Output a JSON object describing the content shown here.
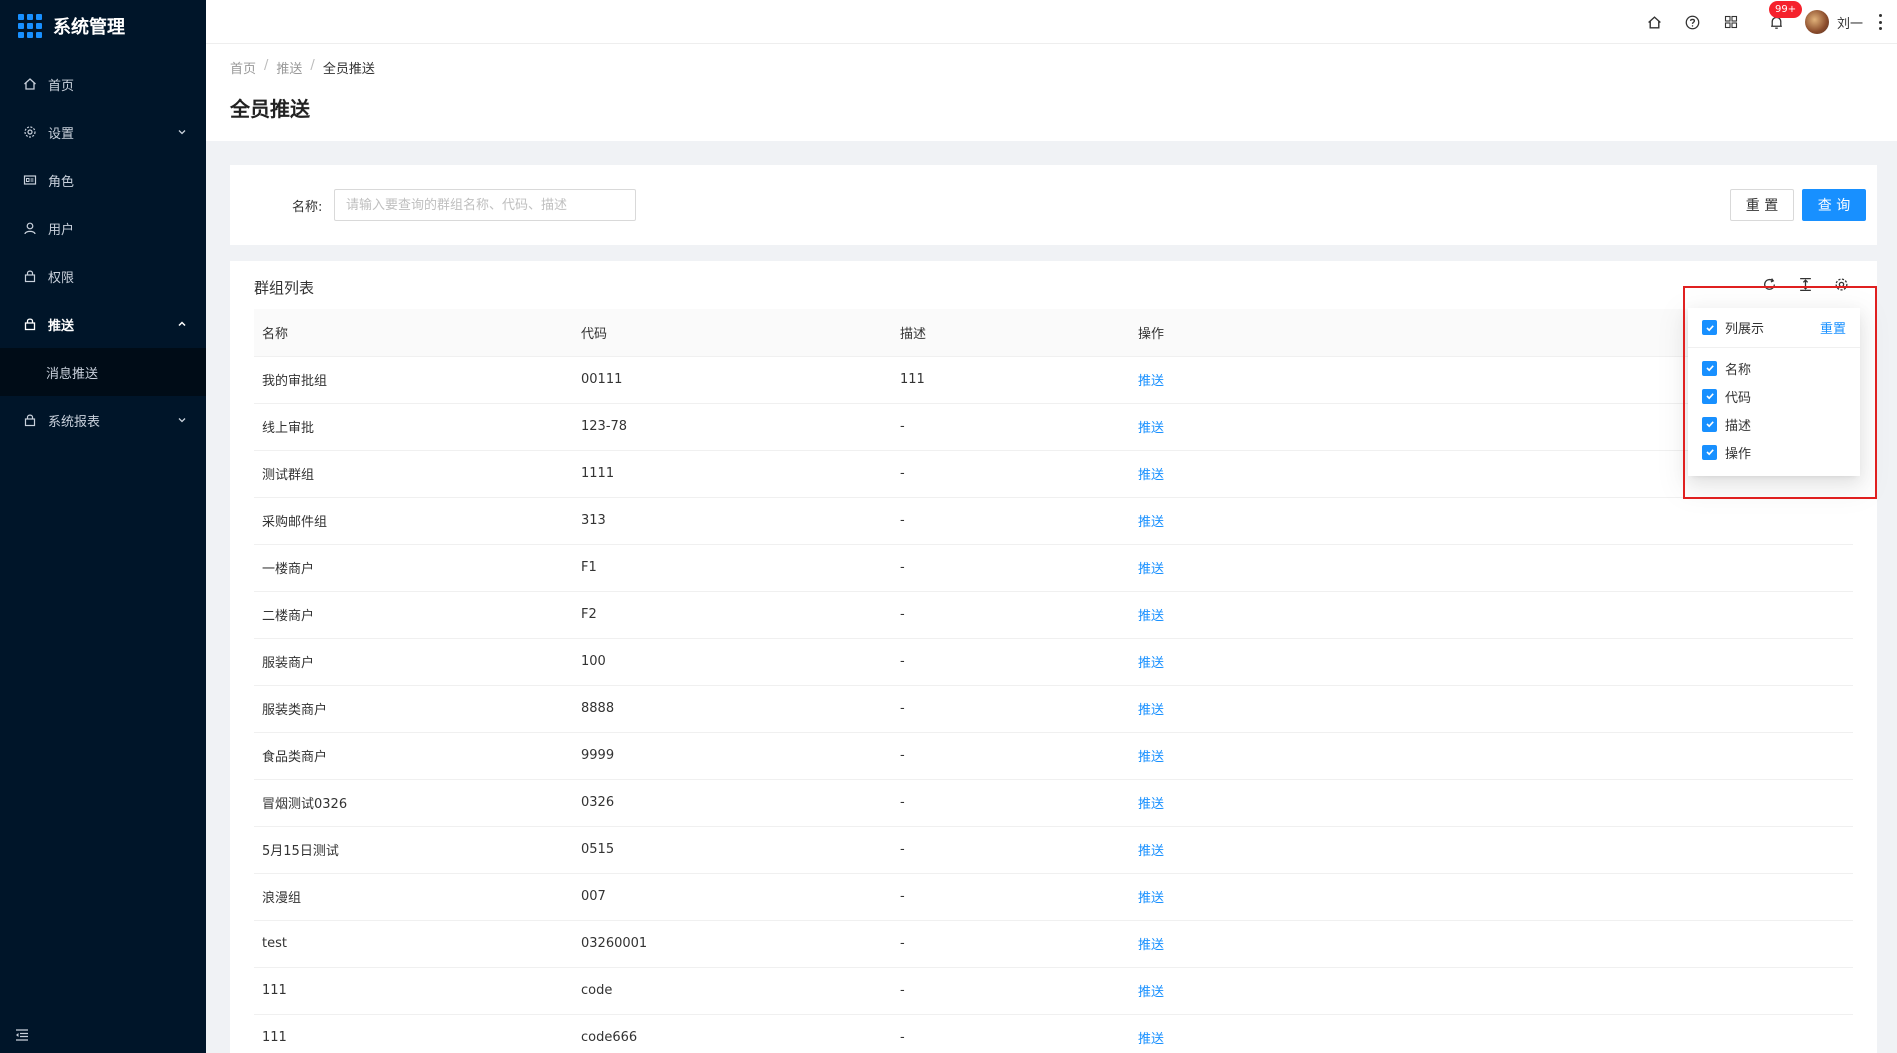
{
  "app": {
    "title": "系统管理"
  },
  "sidebar": {
    "items": [
      {
        "label": "首页",
        "icon": "home-icon"
      },
      {
        "label": "设置",
        "icon": "gear-icon"
      },
      {
        "label": "角色",
        "icon": "id-card-icon"
      },
      {
        "label": "用户",
        "icon": "user-icon"
      },
      {
        "label": "权限",
        "icon": "lock-icon"
      },
      {
        "label": "推送",
        "icon": "lock-icon"
      },
      {
        "label": "系统报表",
        "icon": "lock-icon"
      }
    ],
    "subitems": [
      {
        "label": "消息推送"
      }
    ]
  },
  "header": {
    "badge": "99+",
    "user_name": "刘一"
  },
  "breadcrumb": {
    "home": "首页",
    "parent": "推送",
    "current": "全员推送"
  },
  "page": {
    "title": "全员推送"
  },
  "search": {
    "label": "名称:",
    "placeholder": "请输入要查询的群组名称、代码、描述",
    "reset_label": "重 置",
    "query_label": "查 询"
  },
  "table": {
    "title": "群组列表",
    "columns": [
      "名称",
      "代码",
      "描述",
      "操作"
    ],
    "action_label": "推送",
    "rows": [
      {
        "name": "我的审批组",
        "code": "00111",
        "desc": "111"
      },
      {
        "name": "线上审批",
        "code": "123-78",
        "desc": "-"
      },
      {
        "name": "测试群组",
        "code": "1111",
        "desc": "-"
      },
      {
        "name": "采购邮件组",
        "code": "313",
        "desc": "-"
      },
      {
        "name": "一楼商户",
        "code": "F1",
        "desc": "-"
      },
      {
        "name": "二楼商户",
        "code": "F2",
        "desc": "-"
      },
      {
        "name": "服装商户",
        "code": "100",
        "desc": "-"
      },
      {
        "name": "服装类商户",
        "code": "8888",
        "desc": "-"
      },
      {
        "name": "食品类商户",
        "code": "9999",
        "desc": "-"
      },
      {
        "name": "冒烟测试0326",
        "code": "0326",
        "desc": "-"
      },
      {
        "name": "5月15日测试",
        "code": "0515",
        "desc": "-"
      },
      {
        "name": "浪漫组",
        "code": "007",
        "desc": "-"
      },
      {
        "name": "test",
        "code": "03260001",
        "desc": "-"
      },
      {
        "name": "111",
        "code": "code",
        "desc": "-"
      },
      {
        "name": "111",
        "code": "code666",
        "desc": "-"
      }
    ]
  },
  "column_settings": {
    "title": "列展示",
    "reset_label": "重置",
    "options": [
      "名称",
      "代码",
      "描述",
      "操作"
    ]
  },
  "colors": {
    "sidebar_bg": "#001529",
    "primary": "#1890ff",
    "highlight": "#e02020",
    "badge": "#f5222d"
  }
}
